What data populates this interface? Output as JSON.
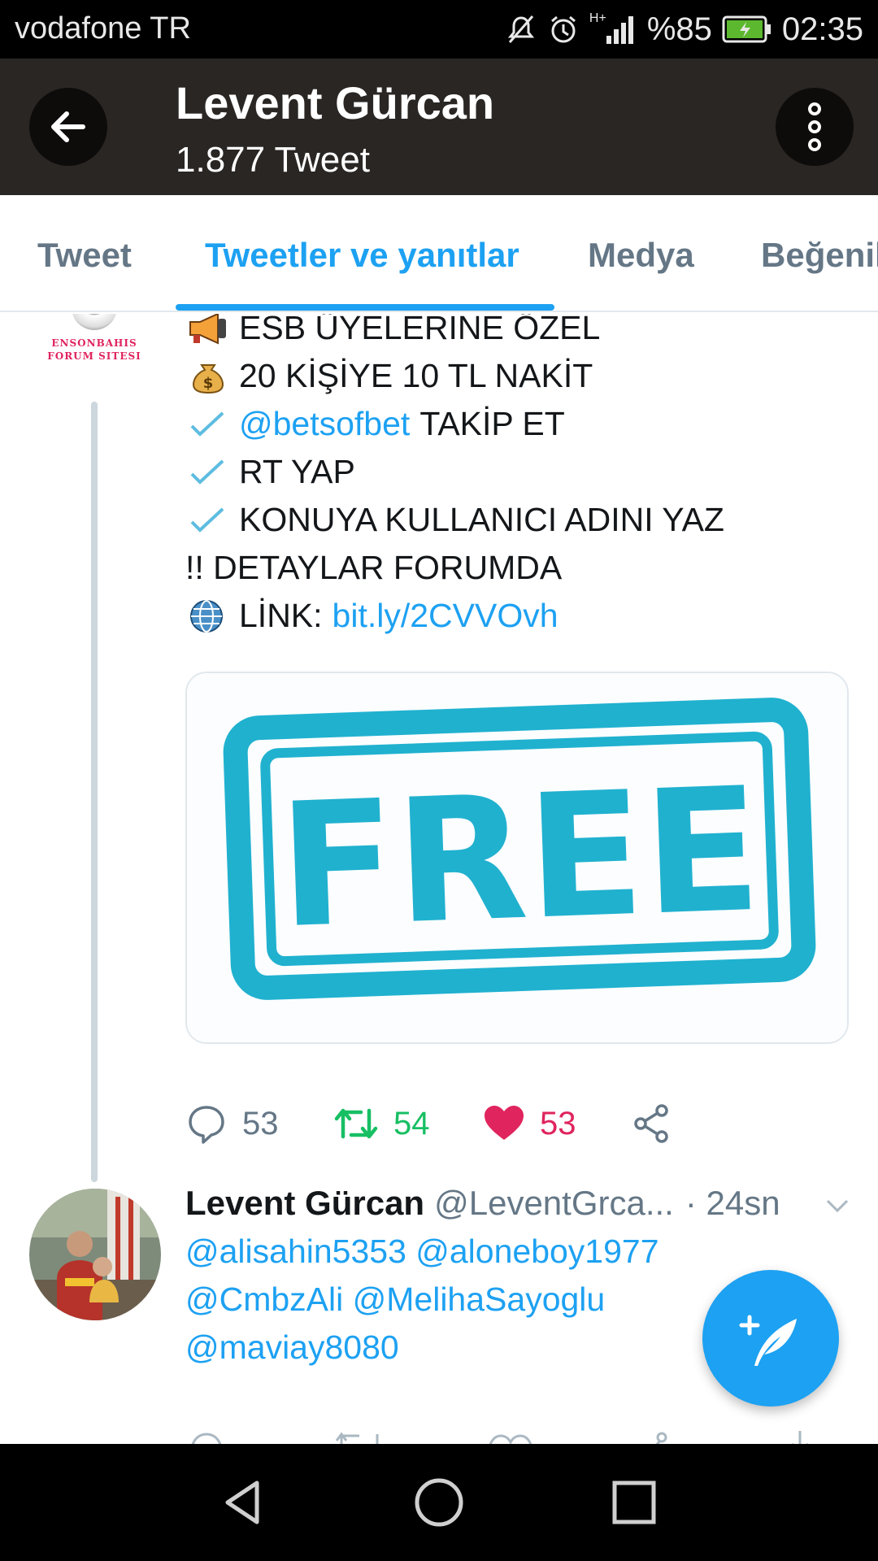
{
  "status_bar": {
    "carrier": "vodafone TR",
    "network": "H+",
    "battery": "%85",
    "time": "02:35"
  },
  "header": {
    "title": "Levent Gürcan",
    "subtitle": "1.877 Tweet"
  },
  "tabs": [
    {
      "label": "Tweet",
      "active": false
    },
    {
      "label": "Tweetler ve yanıtlar",
      "active": true
    },
    {
      "label": "Medya",
      "active": false
    },
    {
      "label": "Beğeniler",
      "active": false
    }
  ],
  "tweet1": {
    "avatar_text": "ENSONBAHIS FORUM SITESI",
    "lines": {
      "l1": "ESB ÜYELERİNE ÖZEL",
      "l2": "20 KİŞİYE 10 TL NAKİT",
      "l3_link": "@betsofbet",
      "l3_text": "TAKİP ET",
      "l4": "RT YAP",
      "l5": "KONUYA KULLANICI ADINI YAZ",
      "l6": "!! DETAYLAR FORUMDA",
      "l7_text": "LİNK:",
      "l7_link": "bit.ly/2CVVOvh"
    },
    "image_text": "FREE",
    "actions": {
      "replies": "53",
      "retweets": "54",
      "likes": "53"
    }
  },
  "tweet2": {
    "name": "Levent Gürcan",
    "handle": "@LeventGrca...",
    "time": "· 24sn",
    "lines": {
      "l1": "@alisahin5353 @aloneboy1977",
      "l2": "@CmbzAli @MelihaSayoglu",
      "l3": "@maviay8080"
    }
  },
  "colors": {
    "accent": "#1da1f2",
    "header_bg": "#2a2624",
    "retweet": "#17bf63",
    "like": "#e0245e",
    "muted": "#657786"
  },
  "icons": [
    "back-arrow-icon",
    "more-vertical-icon",
    "reply-icon",
    "retweet-icon",
    "heart-icon",
    "share-icon",
    "compose-icon",
    "nav-back-icon",
    "nav-home-icon",
    "nav-recents-icon"
  ]
}
